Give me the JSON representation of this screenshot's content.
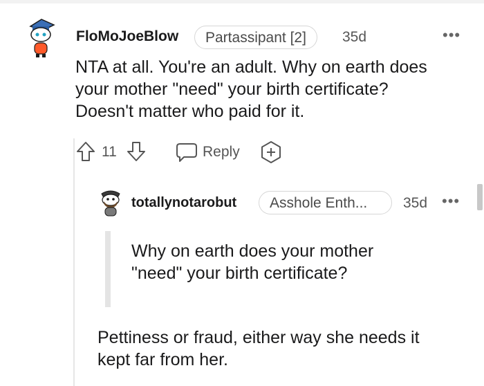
{
  "comment": {
    "username": "FloMoJoeBlow",
    "flair": "Partassipant [2]",
    "time": "35d",
    "more_icon": "more-horizontal-icon",
    "body_lines": [
      "NTA at all. You're an adult. Why on earth does",
      "your mother \"need\" your birth certificate?",
      "Doesn't matter who paid for it."
    ],
    "votes": "11",
    "reply_label": "Reply",
    "icons": {
      "upvote": "upvote-arrow-icon",
      "downvote": "downvote-arrow-icon",
      "reply": "speech-bubble-icon",
      "award": "add-award-icon"
    }
  },
  "reply": {
    "username": "totallynotarobut",
    "flair": "Asshole Enth...",
    "time": "35d",
    "more_icon": "more-horizontal-icon",
    "quote_lines": [
      "Why on earth does your mother",
      "\"need\" your birth certificate?"
    ],
    "body_lines": [
      "Pettiness or fraud, either way she needs it",
      "kept far from her."
    ]
  },
  "colors": {
    "text": "#1a1a1b",
    "muted": "#555555",
    "flair_border": "#d6d6d6",
    "quote_bar": "#e4e4e4",
    "thread_line": "#e6e6e6"
  }
}
